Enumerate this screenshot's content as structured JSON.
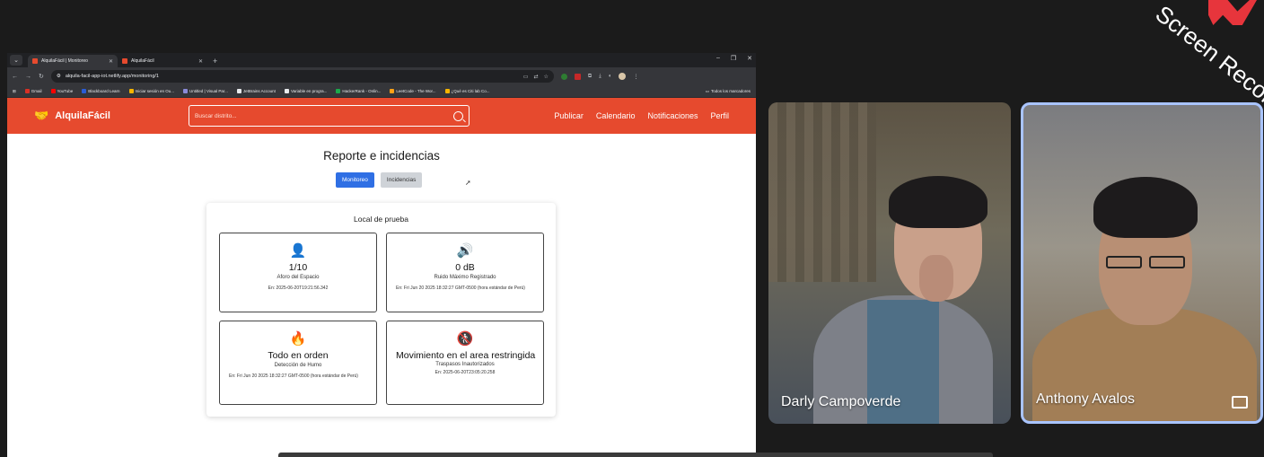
{
  "browser": {
    "tabs": [
      {
        "title": "AlquilaFácil | Monitoreo",
        "active": true
      },
      {
        "title": "AlquilaFácil",
        "active": false
      }
    ],
    "url": "alquila-facil-app-iot.netlify.app/monitoring/1",
    "bookmarks": [
      {
        "label": "Gmail",
        "color": "#d93025"
      },
      {
        "label": "YouTube",
        "color": "#ff0000"
      },
      {
        "label": "Blackboard Learn",
        "color": "#2a5cd6"
      },
      {
        "label": "Iniciar sesión en Ou...",
        "color": "#f5b400"
      },
      {
        "label": "Untitled | Visual Par...",
        "color": "#8a8ad8"
      },
      {
        "label": "JetBrains Account",
        "color": "#e8eaed"
      },
      {
        "label": "Variable en progra...",
        "color": "#e8eaed"
      },
      {
        "label": "HackerRank - Onlin...",
        "color": "#1ba94c"
      },
      {
        "label": "LeetCode - The Wor...",
        "color": "#ffa116"
      },
      {
        "label": "¿Qué es Citi lab Co...",
        "color": "#f5b400"
      }
    ],
    "all_bookmarks": "Todos los marcadores"
  },
  "app": {
    "brand": "AlquilaFácil",
    "search_placeholder": "Buscar distrito...",
    "menu": [
      "Publicar",
      "Calendario",
      "Notificaciones",
      "Perfil"
    ],
    "page_title": "Reporte e incidencias",
    "segments": {
      "monitoring": "Monitoreo",
      "incidents": "Incidencias"
    },
    "card_title": "Local de prueba",
    "tiles": [
      {
        "icon": "person-icon",
        "glyph": "👤",
        "value": "1/10",
        "label": "Aforo del Espacio",
        "time": "En: 2025-06-20T19:21:56.342"
      },
      {
        "icon": "speaker-icon",
        "glyph": "🔊",
        "value": "0 dB",
        "label": "Ruido Máximo Registrado",
        "time": "En: Fri Jun 20 2025 18:32:27 GMT-0500 (hora estándar de Perú)"
      },
      {
        "icon": "fire-icon",
        "glyph": "🔥",
        "value": "Todo en orden",
        "label": "Detección de Humo",
        "time": "En: Fri Jun 20 2025 18:32:27 GMT-0500 (hora estándar de Perú)"
      },
      {
        "icon": "no-pedestrian-icon",
        "glyph": "🚷",
        "value": "Movimiento en el area restringida",
        "label": "Traspasos Inautorizados",
        "time": "En: 2025-06-20T23:05:20.258"
      }
    ]
  },
  "participants": [
    {
      "name": "Darly Campoverde"
    },
    {
      "name": "Anthony Avalos"
    }
  ],
  "watermark": "Screen Recorder"
}
